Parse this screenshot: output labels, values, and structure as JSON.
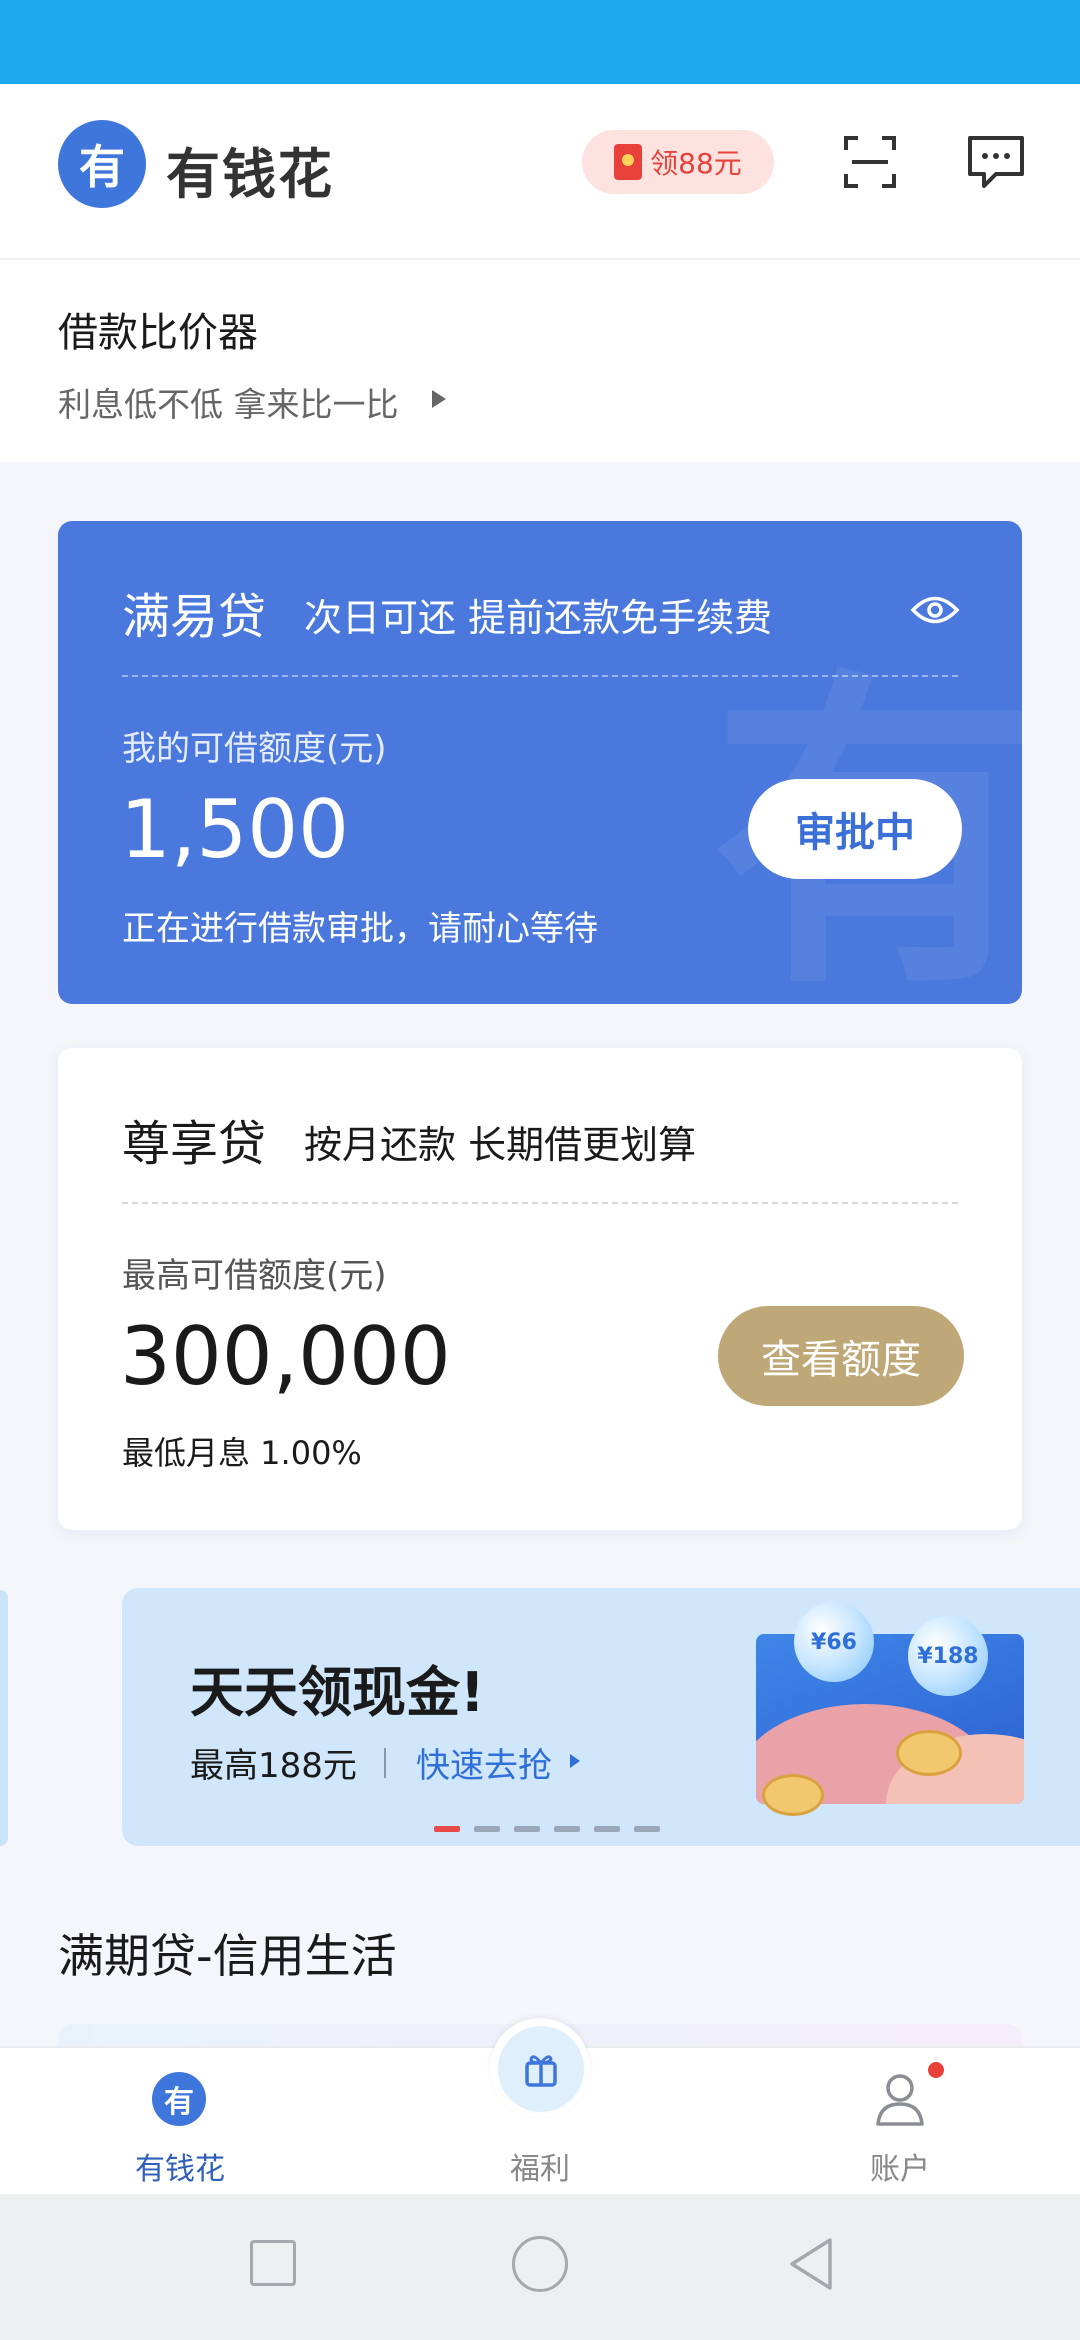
{
  "header": {
    "logo_glyph": "有",
    "app_title": "有钱花",
    "promo_label": "领88元",
    "icons": [
      "scan-icon",
      "message-icon",
      "red-packet-icon"
    ]
  },
  "compare": {
    "title": "借款比价器",
    "subtitle": "利息低不低 拿来比一比"
  },
  "loan_card_1": {
    "name": "满易贷",
    "tagline": "次日可还 提前还款免手续费",
    "limit_label": "我的可借额度(元)",
    "amount": "1,500",
    "status_button": "审批中",
    "note": "正在进行借款审批，请耐心等待",
    "accent_color": "#4a78dd"
  },
  "loan_card_2": {
    "name": "尊享贷",
    "tagline": "按月还款 长期借更划算",
    "limit_label": "最高可借额度(元)",
    "amount": "300,000",
    "action_button": "查看额度",
    "note": "最低月息 1.00%",
    "button_color": "#bfa877"
  },
  "banner": {
    "title": "天天领现金!",
    "subtitle": "最高188元",
    "link": "快速去抢",
    "bubble_1": "¥66",
    "bubble_2": "¥188",
    "active_index": 0,
    "total_dots": 6
  },
  "section": {
    "title": "满期贷-信用生活"
  },
  "tabs": [
    {
      "label": "有钱花",
      "glyph": "有",
      "active": true
    },
    {
      "label": "福利",
      "active": false
    },
    {
      "label": "账户",
      "active": false,
      "badge": true
    }
  ]
}
